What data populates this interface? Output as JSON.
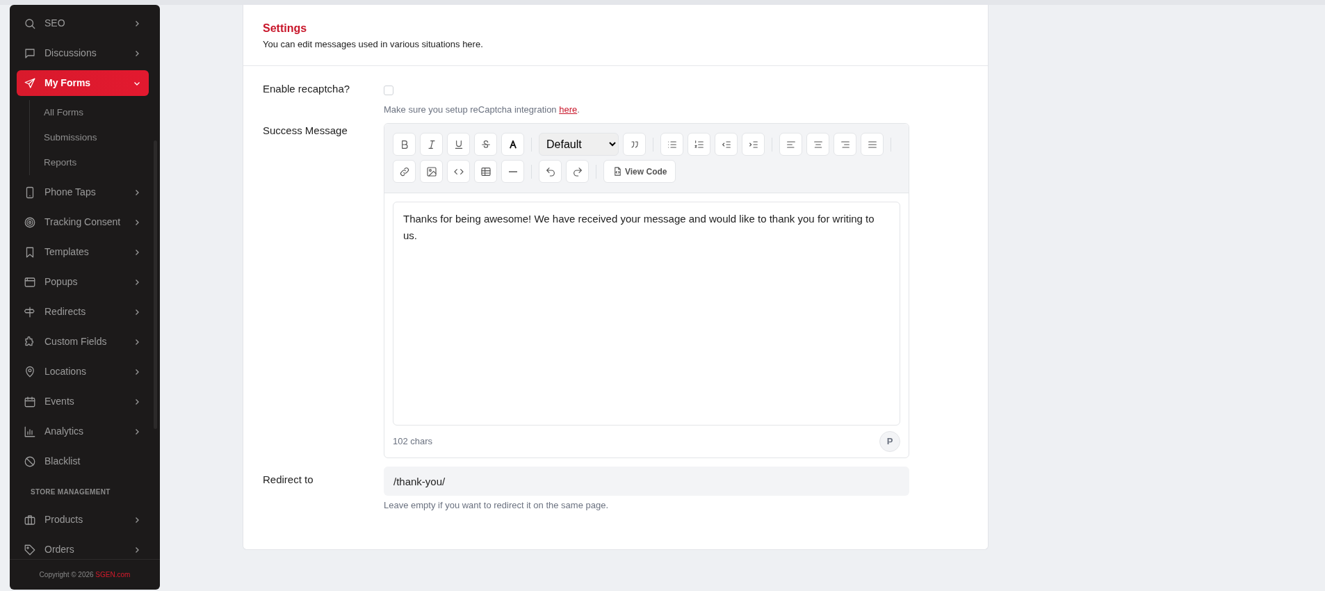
{
  "sidebar": {
    "items": [
      {
        "kind": "item",
        "label": "SEO",
        "expandable": true,
        "expanded": false,
        "selected": false
      },
      {
        "kind": "item",
        "label": "Discussions",
        "expandable": true,
        "expanded": false,
        "selected": false
      },
      {
        "kind": "item",
        "label": "My Forms",
        "expandable": true,
        "expanded": true,
        "selected": true,
        "children": [
          {
            "label": "All Forms"
          },
          {
            "label": "Submissions"
          },
          {
            "label": "Reports"
          }
        ]
      },
      {
        "kind": "item",
        "label": "Phone Taps",
        "expandable": true,
        "expanded": false,
        "selected": false
      },
      {
        "kind": "item",
        "label": "Tracking Consent",
        "expandable": true,
        "expanded": false,
        "selected": false
      },
      {
        "kind": "item",
        "label": "Templates",
        "expandable": true,
        "expanded": false,
        "selected": false
      },
      {
        "kind": "item",
        "label": "Popups",
        "expandable": true,
        "expanded": false,
        "selected": false
      },
      {
        "kind": "item",
        "label": "Redirects",
        "expandable": true,
        "expanded": false,
        "selected": false
      },
      {
        "kind": "item",
        "label": "Custom Fields",
        "expandable": true,
        "expanded": false,
        "selected": false
      },
      {
        "kind": "item",
        "label": "Locations",
        "expandable": true,
        "expanded": false,
        "selected": false
      },
      {
        "kind": "item",
        "label": "Events",
        "expandable": true,
        "expanded": false,
        "selected": false
      },
      {
        "kind": "item",
        "label": "Analytics",
        "expandable": true,
        "expanded": false,
        "selected": false
      },
      {
        "kind": "item",
        "label": "Blacklist",
        "expandable": false,
        "selected": false
      },
      {
        "kind": "section",
        "label": "STORE MANAGEMENT"
      },
      {
        "kind": "item",
        "label": "Products",
        "expandable": true,
        "expanded": false,
        "selected": false
      },
      {
        "kind": "item",
        "label": "Orders",
        "expandable": true,
        "expanded": false,
        "selected": false
      }
    ],
    "footer": {
      "text": "Copyright © 2026",
      "link": "SGEN.com"
    }
  },
  "settings": {
    "title": "Settings",
    "subtitle": "You can edit messages used in various situations here.",
    "recaptcha": {
      "label": "Enable recaptcha?",
      "checked": false,
      "hint": "Make sure you setup reCaptcha integration",
      "hint_link": "here",
      "hint_end": "."
    },
    "success": {
      "label": "Success Message",
      "font_select": "Default",
      "view_code": "View Code",
      "content": "Thanks for being awesome! We have received your message and would like to thank you for writing to us.",
      "char_count": "102 chars",
      "avatar": "P"
    },
    "redirect": {
      "label": "Redirect to",
      "value": "/thank-you/",
      "hint": "Leave empty if you want to redirect it on the same page."
    }
  }
}
